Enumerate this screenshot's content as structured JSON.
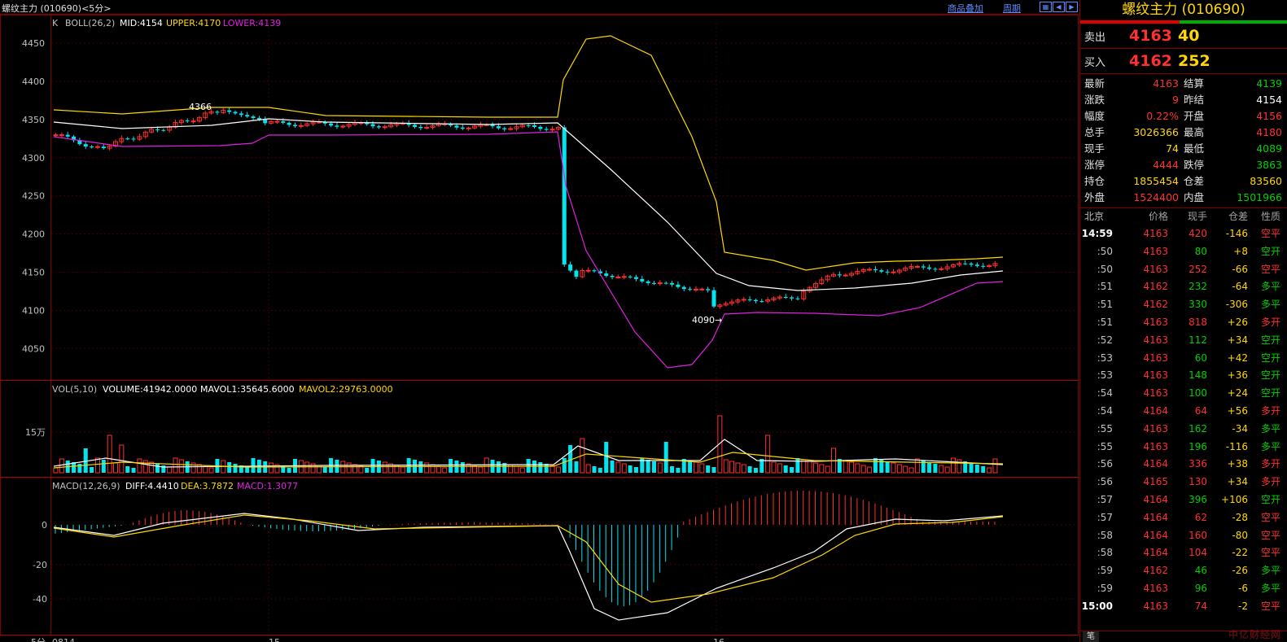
{
  "window": {
    "title": "螺纹主力 (010690)<5分>",
    "link_overlay": "商品叠加",
    "link_period": "周期",
    "nav_icons": [
      "grid-icon",
      "left-arrow-icon",
      "right-arrow-icon"
    ]
  },
  "price_axis": [
    "4450",
    "4400",
    "4350",
    "4300",
    "4250",
    "4200",
    "4150",
    "4100",
    "4050"
  ],
  "boll_header": {
    "name": "K",
    "indicator": "BOLL(26,2)",
    "mid": "MID:4154",
    "upper": "UPPER:4170",
    "lower": "LOWER:4139"
  },
  "annotations": {
    "high": "4366",
    "low": "4090→"
  },
  "vol_header": {
    "name": "VOL(5,10)",
    "volume": "VOLUME:41942.0000",
    "ma1": "MAVOL1:35645.6000",
    "ma2": "MAVOL2:29763.0000"
  },
  "vol_axis": "15万",
  "macd_header": {
    "name": "MACD(12,26,9)",
    "diff": "DIFF:4.4410",
    "dea": "DEA:3.7872",
    "macd": "MACD:1.3077"
  },
  "macd_axis": [
    "0",
    "-20",
    "-40"
  ],
  "time_axis": {
    "period": "5分",
    "labels": [
      "0814",
      "15",
      "16"
    ]
  },
  "colors": {
    "up": "#ff3030",
    "down": "#00e5ee",
    "yellow": "#ffd700",
    "magenta": "#e020e0",
    "white": "#ffffff",
    "grid": "#800000"
  },
  "quote": {
    "name": "螺纹主力 (010690)",
    "sell_label": "卖出",
    "sell_price": "4163",
    "sell_vol": "40",
    "buy_label": "买入",
    "buy_price": "4162",
    "buy_vol": "252",
    "stats": [
      {
        "k": "最新",
        "v": "4163",
        "vc": "up",
        "k2": "结算",
        "v2": "4139",
        "v2c": "down"
      },
      {
        "k": "涨跌",
        "v": "9",
        "vc": "up",
        "k2": "昨结",
        "v2": "4154",
        "v2c": "wht"
      },
      {
        "k": "幅度",
        "v": "0.22%",
        "vc": "up",
        "k2": "开盘",
        "v2": "4156",
        "v2c": "up"
      },
      {
        "k": "总手",
        "v": "3026366",
        "vc": "yel",
        "k2": "最高",
        "v2": "4180",
        "v2c": "up"
      },
      {
        "k": "现手",
        "v": "74",
        "vc": "yel",
        "k2": "最低",
        "v2": "4089",
        "v2c": "down"
      },
      {
        "k": "涨停",
        "v": "4444",
        "vc": "up",
        "k2": "跌停",
        "v2": "3863",
        "v2c": "down"
      },
      {
        "k": "持仓",
        "v": "1855454",
        "vc": "yel",
        "k2": "仓差",
        "v2": "83560",
        "v2c": "yel"
      },
      {
        "k": "外盘",
        "v": "1524400",
        "vc": "up",
        "k2": "内盘",
        "v2": "1501966",
        "v2c": "down"
      }
    ],
    "tick_headers": [
      "北京",
      "价格",
      "现手",
      "仓差",
      "性质"
    ],
    "ticks": [
      {
        "t": "14:59",
        "p": "4163",
        "pc": "up",
        "v": "420",
        "vc": "up",
        "d": "-146",
        "dc": "yel",
        "n": "空平",
        "nc": "up",
        "bold": true
      },
      {
        "t": ":50",
        "p": "4163",
        "pc": "up",
        "v": "80",
        "vc": "down",
        "d": "+8",
        "dc": "yel",
        "n": "空开",
        "nc": "down"
      },
      {
        "t": ":50",
        "p": "4163",
        "pc": "up",
        "v": "252",
        "vc": "up",
        "d": "-66",
        "dc": "yel",
        "n": "空平",
        "nc": "up"
      },
      {
        "t": ":51",
        "p": "4162",
        "pc": "up",
        "v": "232",
        "vc": "down",
        "d": "-64",
        "dc": "yel",
        "n": "多平",
        "nc": "down"
      },
      {
        "t": ":51",
        "p": "4162",
        "pc": "up",
        "v": "330",
        "vc": "down",
        "d": "-306",
        "dc": "yel",
        "n": "多平",
        "nc": "down"
      },
      {
        "t": ":51",
        "p": "4163",
        "pc": "up",
        "v": "818",
        "vc": "up",
        "d": "+26",
        "dc": "yel",
        "n": "多开",
        "nc": "up"
      },
      {
        "t": ":52",
        "p": "4163",
        "pc": "up",
        "v": "112",
        "vc": "down",
        "d": "+34",
        "dc": "yel",
        "n": "空开",
        "nc": "down"
      },
      {
        "t": ":53",
        "p": "4163",
        "pc": "up",
        "v": "60",
        "vc": "down",
        "d": "+42",
        "dc": "yel",
        "n": "空开",
        "nc": "down"
      },
      {
        "t": ":53",
        "p": "4163",
        "pc": "up",
        "v": "148",
        "vc": "down",
        "d": "+36",
        "dc": "yel",
        "n": "空开",
        "nc": "down"
      },
      {
        "t": ":54",
        "p": "4163",
        "pc": "up",
        "v": "100",
        "vc": "down",
        "d": "+24",
        "dc": "yel",
        "n": "空开",
        "nc": "down"
      },
      {
        "t": ":54",
        "p": "4164",
        "pc": "up",
        "v": "64",
        "vc": "up",
        "d": "+56",
        "dc": "yel",
        "n": "多开",
        "nc": "up"
      },
      {
        "t": ":55",
        "p": "4163",
        "pc": "up",
        "v": "162",
        "vc": "down",
        "d": "-34",
        "dc": "yel",
        "n": "多平",
        "nc": "down"
      },
      {
        "t": ":55",
        "p": "4163",
        "pc": "up",
        "v": "196",
        "vc": "down",
        "d": "-116",
        "dc": "yel",
        "n": "多平",
        "nc": "down"
      },
      {
        "t": ":56",
        "p": "4164",
        "pc": "up",
        "v": "336",
        "vc": "up",
        "d": "+38",
        "dc": "yel",
        "n": "多开",
        "nc": "up"
      },
      {
        "t": ":56",
        "p": "4165",
        "pc": "up",
        "v": "130",
        "vc": "up",
        "d": "+34",
        "dc": "yel",
        "n": "多开",
        "nc": "up"
      },
      {
        "t": ":57",
        "p": "4164",
        "pc": "up",
        "v": "396",
        "vc": "down",
        "d": "+106",
        "dc": "yel",
        "n": "空开",
        "nc": "down"
      },
      {
        "t": ":57",
        "p": "4164",
        "pc": "up",
        "v": "62",
        "vc": "up",
        "d": "-28",
        "dc": "yel",
        "n": "空平",
        "nc": "up"
      },
      {
        "t": ":58",
        "p": "4164",
        "pc": "up",
        "v": "160",
        "vc": "up",
        "d": "-80",
        "dc": "yel",
        "n": "空平",
        "nc": "up"
      },
      {
        "t": ":58",
        "p": "4164",
        "pc": "up",
        "v": "104",
        "vc": "up",
        "d": "-22",
        "dc": "yel",
        "n": "空平",
        "nc": "up"
      },
      {
        "t": ":59",
        "p": "4162",
        "pc": "up",
        "v": "46",
        "vc": "down",
        "d": "-26",
        "dc": "yel",
        "n": "多平",
        "nc": "down"
      },
      {
        "t": ":59",
        "p": "4163",
        "pc": "up",
        "v": "96",
        "vc": "down",
        "d": "-6",
        "dc": "yel",
        "n": "多平",
        "nc": "down"
      },
      {
        "t": "15:00",
        "p": "4163",
        "pc": "up",
        "v": "74",
        "vc": "up",
        "d": "-2",
        "dc": "yel",
        "n": "空平",
        "nc": "up",
        "bold": true
      }
    ],
    "tab": "笔",
    "watermark": "中亿财经网"
  }
}
